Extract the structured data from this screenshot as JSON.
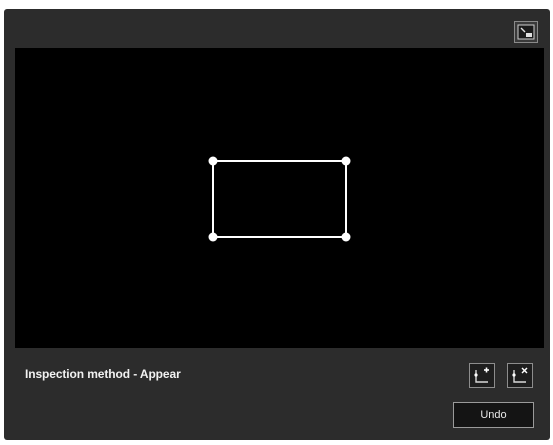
{
  "inspection": {
    "method_label": "Inspection method - Appear"
  },
  "toolbar": {
    "undo_label": "Undo"
  },
  "icons": {
    "view_toggle": "display-toggle-icon",
    "add_point": "add-vertex-icon",
    "remove_point": "remove-vertex-icon"
  },
  "region": {
    "shape": "rectangle",
    "vertex_count": 4
  },
  "colors": {
    "panel_background": "#2c2c2c",
    "stage_background": "#000000",
    "region_outline": "#ffffff"
  }
}
